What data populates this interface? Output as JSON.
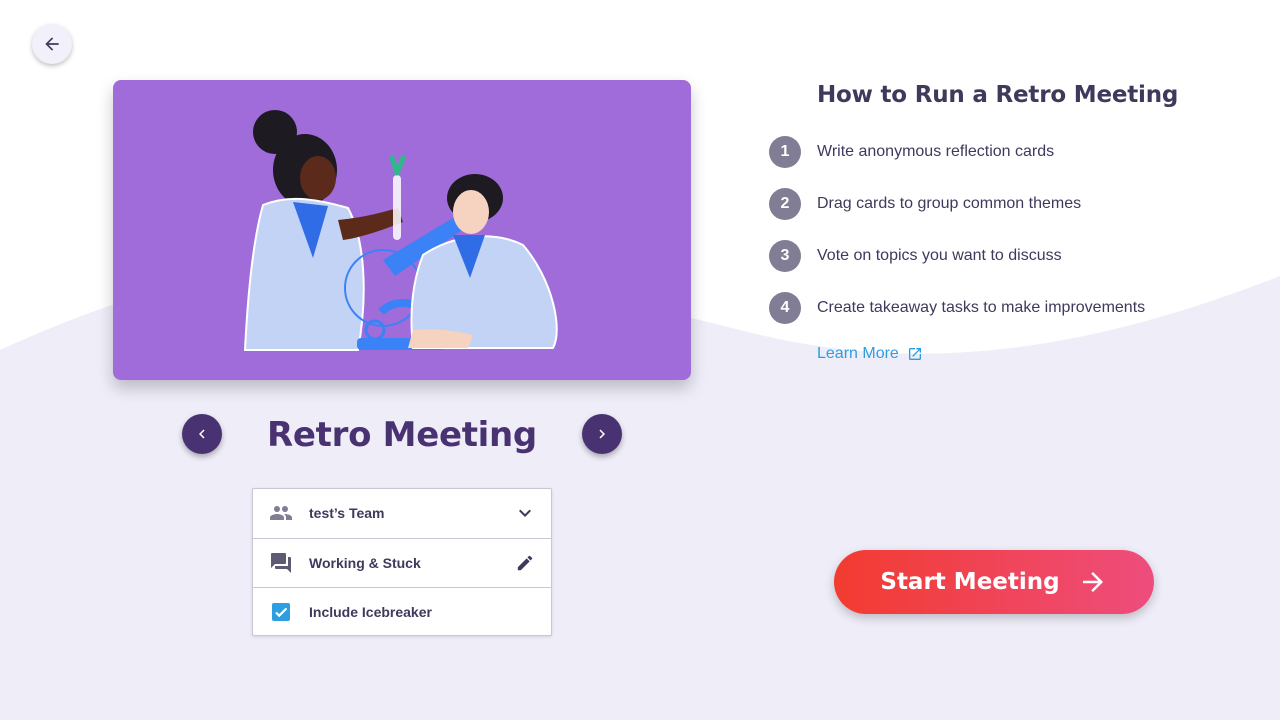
{
  "back": {
    "icon": "arrow-left-icon"
  },
  "illustration": {
    "background": "#9f6cd9"
  },
  "carousel": {
    "title": "Retro Meeting",
    "prev_icon": "chevron-left-icon",
    "next_icon": "chevron-right-icon"
  },
  "settings": {
    "team": {
      "label": "test’s Team",
      "icon": "group-icon",
      "trail_icon": "chevron-down-icon"
    },
    "template": {
      "label": "Working & Stuck",
      "icon": "forum-icon",
      "trail_icon": "pencil-icon"
    },
    "icebreaker": {
      "label": "Include Icebreaker",
      "checked": true,
      "icon": "checkbox-icon"
    }
  },
  "guide": {
    "title": "How to Run a Retro Meeting",
    "steps": [
      {
        "num": "1",
        "text": "Write anonymous reflection cards"
      },
      {
        "num": "2",
        "text": "Drag cards to group common themes"
      },
      {
        "num": "3",
        "text": "Vote on topics you want to discuss"
      },
      {
        "num": "4",
        "text": "Create takeaway tasks to make improvements"
      }
    ],
    "learn_more": "Learn More",
    "learn_more_icon": "open-in-new-icon"
  },
  "start": {
    "label": "Start Meeting",
    "icon": "arrow-right-icon"
  },
  "colors": {
    "accent": "#493272",
    "link": "#2d9ee0",
    "start_from": "#f23b30",
    "start_to": "#ee4d7d",
    "wave": "#efedf8"
  }
}
